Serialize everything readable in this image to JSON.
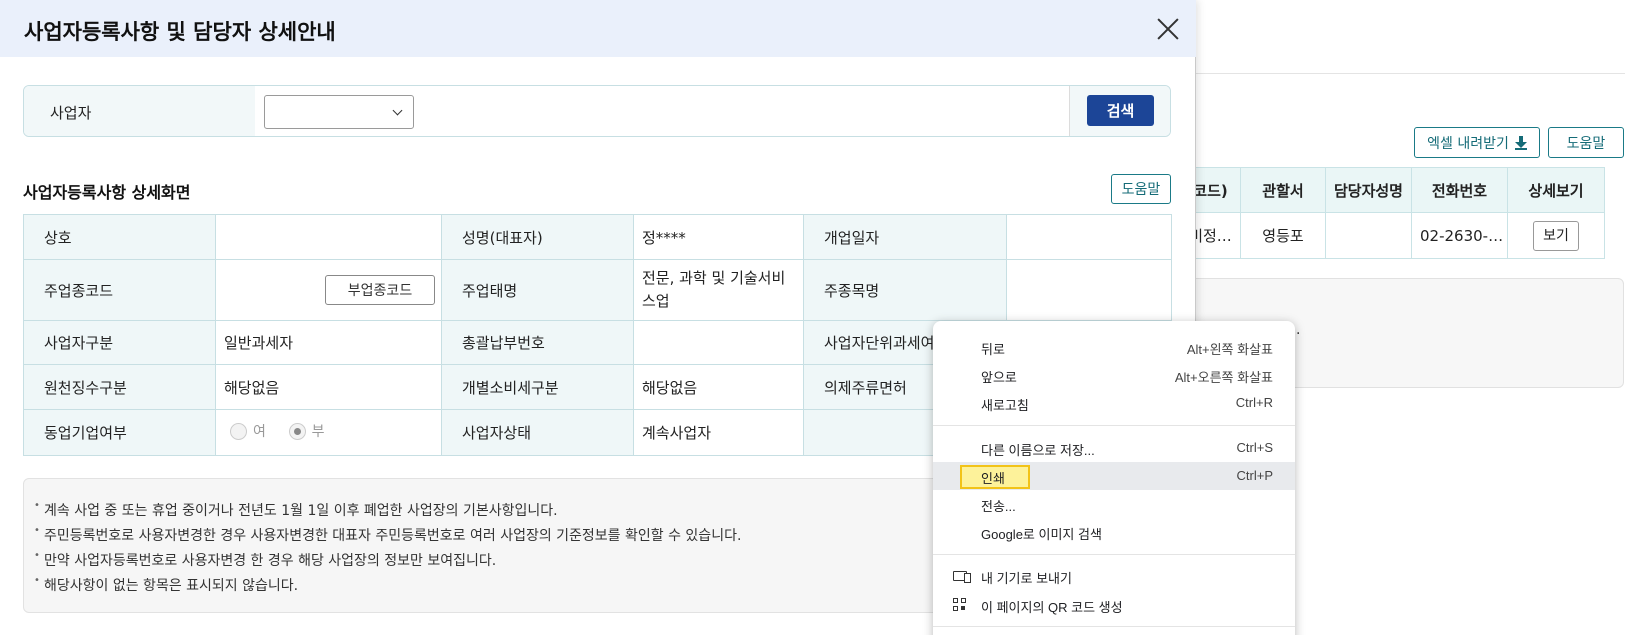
{
  "background": {
    "excel_button": "엑셀 내려받기",
    "help_button": "도움말",
    "table_headers": [
      "코드)",
      "관할서",
      "담당자성명",
      "전화번호",
      "상세보기"
    ],
    "table_row": [
      "비정…",
      "영등포",
      "",
      "02-2630-…",
      "보기"
    ],
    "box_dot": "."
  },
  "modal": {
    "title": "사업자등록사항 및 담당자 상세안내",
    "search": {
      "label": "사업자",
      "select_value": "",
      "button": "검색"
    },
    "section_title": "사업자등록사항 상세화면",
    "help_button": "도움말",
    "rows": [
      {
        "l1": "상호",
        "v1": "",
        "l2": "성명(대표자)",
        "v2": "정****",
        "l3": "개업일자",
        "v3": ""
      },
      {
        "l1": "주업종코드",
        "v1": "",
        "btn": "부업종코드",
        "l2": "주업태명",
        "v2": "전문, 과학 및 기술서비스업",
        "l3": "주종목명",
        "v3": ""
      },
      {
        "l1": "사업자구분",
        "v1": "일반과세자",
        "l2": "총괄납부번호",
        "v2": "",
        "l3": "사업자단위과세여",
        "v3": ""
      },
      {
        "l1": "원천징수구분",
        "v1": "해당없음",
        "l2": "개별소비세구분",
        "v2": "해당없음",
        "l3": "의제주류면허",
        "v3": ""
      },
      {
        "l1": "동업기업여부",
        "r1": "여",
        "r2": "부",
        "l2": "사업자상태",
        "v2": "계속사업자",
        "l3": "",
        "v3": ""
      }
    ],
    "notices": [
      "계속 사업 중 또는 휴업 중이거나 전년도 1월 1일 이후 폐업한 사업장의 기본사항입니다.",
      "주민등록번호로 사용자변경한 경우 사용자변경한 대표자 주민등록번호로 여러 사업장의 기준정보를 확인할 수 있습니다.",
      "만약 사업자등록번호로 사용자변경 한 경우 해당 사업장의 정보만 보여집니다.",
      "해당사항이 없는 항목은 표시되지 않습니다."
    ]
  },
  "context_menu": {
    "items": [
      {
        "label": "뒤로",
        "shortcut": "Alt+왼쪽 화살표"
      },
      {
        "label": "앞으로",
        "shortcut": "Alt+오른쪽 화살표"
      },
      {
        "label": "새로고침",
        "shortcut": "Ctrl+R"
      },
      {
        "label": "다른 이름으로 저장...",
        "shortcut": "Ctrl+S"
      },
      {
        "label": "인쇄",
        "shortcut": "Ctrl+P"
      },
      {
        "label": "전송...",
        "shortcut": ""
      },
      {
        "label": "Google로 이미지 검색",
        "shortcut": ""
      },
      {
        "label": "내 기기로 보내기",
        "shortcut": ""
      },
      {
        "label": "이 페이지의 QR 코드 생성",
        "shortcut": ""
      }
    ]
  }
}
